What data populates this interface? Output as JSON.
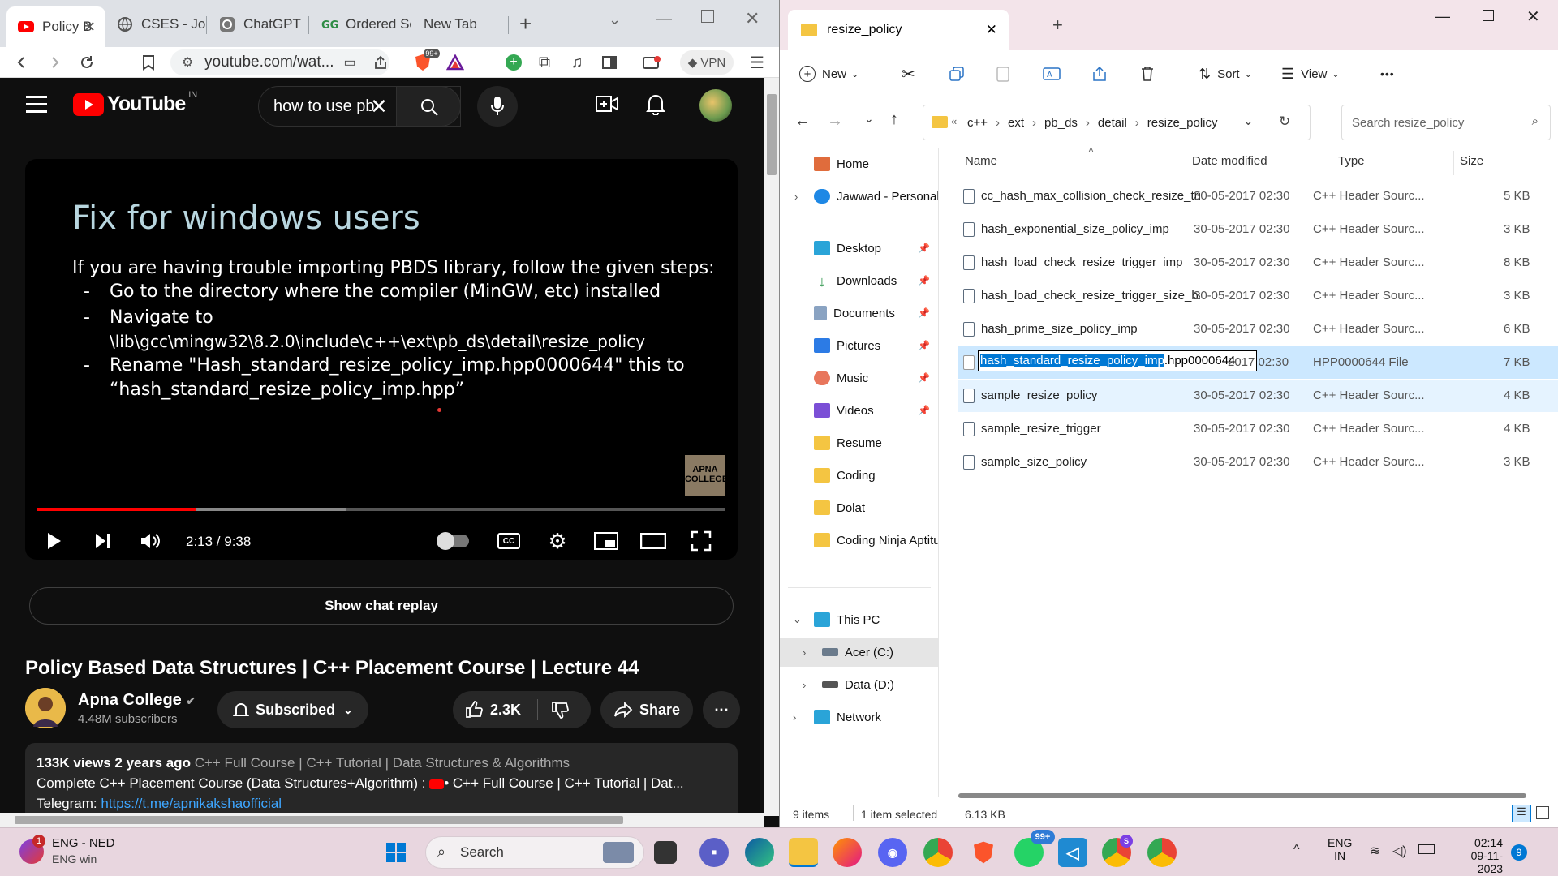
{
  "browser": {
    "tabs": [
      {
        "label": "Policy B"
      },
      {
        "label": "CSES - Jose"
      },
      {
        "label": "ChatGPT"
      },
      {
        "label": "Ordered Se"
      },
      {
        "label": "New Tab"
      }
    ],
    "new_tab": "+",
    "url": "youtube.com/wat...",
    "brave_badge": "99+",
    "vpn_label": "VPN"
  },
  "youtube": {
    "logo": "YouTube",
    "region": "IN",
    "search_value": "how to use pb",
    "slide": {
      "title": "Fix for windows users",
      "lines": [
        "If you are having trouble importing  PBDS library, follow the given steps:",
        "Go to the directory where the compiler (MinGW, etc) installed",
        "Navigate to",
        "\\lib\\gcc\\mingw32\\8.2.0\\include\\c++\\ext\\pb_ds\\detail\\resize_policy",
        "Rename \"Hash_standard_resize_policy_imp.hpp0000644\" this to",
        "“hash_standard_resize_policy_imp.hpp”"
      ],
      "bullet": "-",
      "watermark": "APNA COLLEGE"
    },
    "player": {
      "time": "2:13 / 9:38",
      "progress_fraction": 0.231,
      "buffered_fraction": 0.449
    },
    "show_chat": "Show chat replay",
    "video_title": "Policy Based Data Structures | C++ Placement Course | Lecture 44",
    "channel": "Apna College",
    "subscribers": "4.48M subscribers",
    "subscribed": "Subscribed",
    "likes": "2.3K",
    "share": "Share",
    "desc_line1_stats": "133K views  2 years ago",
    "desc_line1_tags": "C++ Full Course | C++ Tutorial | Data Structures & Algorithms",
    "desc_line2": "Complete C++ Placement Course (Data Structures+Algorithm) :",
    "desc_line2_link": "• C++ Full Course |  C++ Tutorial | Dat...",
    "desc_line3_label": "Telegram:",
    "desc_line3_link": "https://t.me/apnikakshaofficial"
  },
  "explorer": {
    "title": "resize_policy",
    "commands": {
      "new": "New",
      "sort": "Sort",
      "view": "View",
      "more": "•••"
    },
    "breadcrumb": [
      "c++",
      "ext",
      "pb_ds",
      "detail",
      "resize_policy"
    ],
    "breadcrumb_prefix": "«",
    "search_placeholder": "Search resize_policy",
    "nav": {
      "home": "Home",
      "personal": "Jawwad - Personal",
      "desktop": "Desktop",
      "downloads": "Downloads",
      "documents": "Documents",
      "pictures": "Pictures",
      "music": "Music",
      "videos": "Videos",
      "resume": "Resume",
      "coding": "Coding",
      "dolat": "Dolat",
      "ninja": "Coding Ninja Aptitu",
      "thispc": "This PC",
      "acer": "Acer (C:)",
      "data": "Data (D:)",
      "network": "Network"
    },
    "columns": {
      "name": "Name",
      "date": "Date modified",
      "type": "Type",
      "size": "Size"
    },
    "files": [
      {
        "name": "cc_hash_max_collision_check_resize_trigg...",
        "date": "30-05-2017 02:30",
        "type": "C++ Header Sourc...",
        "size": "5 KB"
      },
      {
        "name": "hash_exponential_size_policy_imp",
        "date": "30-05-2017 02:30",
        "type": "C++ Header Sourc...",
        "size": "3 KB"
      },
      {
        "name": "hash_load_check_resize_trigger_imp",
        "date": "30-05-2017 02:30",
        "type": "C++ Header Sourc...",
        "size": "8 KB"
      },
      {
        "name": "hash_load_check_resize_trigger_size_base",
        "date": "30-05-2017 02:30",
        "type": "C++ Header Sourc...",
        "size": "3 KB"
      },
      {
        "name": "hash_prime_size_policy_imp",
        "date": "30-05-2017 02:30",
        "type": "C++ Header Sourc...",
        "size": "6 KB"
      },
      {
        "name": "hash_standard_resize_policy_imp.hpp0000644",
        "date": "2017 02:30",
        "type": "HPP0000644 File",
        "size": "7 KB"
      },
      {
        "name": "sample_resize_policy",
        "date": "30-05-2017 02:30",
        "type": "C++ Header Sourc...",
        "size": "4 KB"
      },
      {
        "name": "sample_resize_trigger",
        "date": "30-05-2017 02:30",
        "type": "C++ Header Sourc...",
        "size": "4 KB"
      },
      {
        "name": "sample_size_policy",
        "date": "30-05-2017 02:30",
        "type": "C++ Header Sourc...",
        "size": "3 KB"
      }
    ],
    "rename_selected": "hash_standard_resize_policy_imp",
    "rename_rest": ".hpp0000644",
    "status": {
      "count": "9 items",
      "selected": "1 item selected",
      "size": "6.13 KB"
    }
  },
  "taskbar": {
    "lang1": "ENG - NED",
    "lang2": "ENG win",
    "notif": "1",
    "search": "Search",
    "whatsapp_badge": "99+",
    "tray_lang1": "ENG",
    "tray_lang2": "IN",
    "time": "02:14",
    "date": "09-11-2023",
    "notif_count": "9"
  },
  "colors": {
    "yt_red": "#ff0000",
    "selection": "#cce8ff",
    "accent": "#0078d4"
  }
}
